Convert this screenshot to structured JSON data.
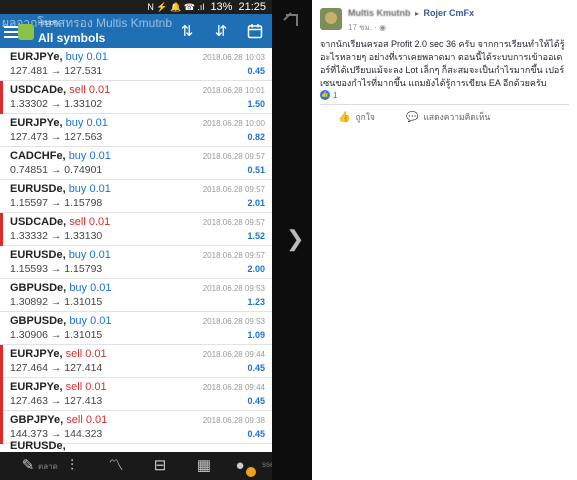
{
  "phone": {
    "status": {
      "signal_text": "N ⚡ 🔔 ☎ .ıl",
      "battery": "13%",
      "time": "21:25"
    },
    "appbar": {
      "overlay_text": "ผลจากโบรสทรอง Multis Kmutnb",
      "subtitle": "History",
      "title": "All symbols",
      "icons": [
        "sort-icon",
        "transfer-icon",
        "calendar-icon"
      ]
    },
    "trades": [
      {
        "symbol": "EURJPYe,",
        "side": "buy 0.01",
        "prices": "127.481 → 127.531",
        "date": "2018.06.28 10:03",
        "profit": "0.45"
      },
      {
        "symbol": "USDCADe,",
        "side": "sell 0.01",
        "prices": "1.33302 → 1.33102",
        "date": "2018.06.28 10:01",
        "profit": "1.50"
      },
      {
        "symbol": "EURJPYe,",
        "side": "buy 0.01",
        "prices": "127.473 → 127.563",
        "date": "2018.06.28 10:00",
        "profit": "0.82"
      },
      {
        "symbol": "CADCHFe,",
        "side": "buy 0.01",
        "prices": "0.74851 → 0.74901",
        "date": "2018.06.28 09:57",
        "profit": "0.51"
      },
      {
        "symbol": "EURUSDe,",
        "side": "buy 0.01",
        "prices": "1.15597 → 1.15798",
        "date": "2018.06.28 09:57",
        "profit": "2.01"
      },
      {
        "symbol": "USDCADe,",
        "side": "sell 0.01",
        "prices": "1.33332 → 1.33130",
        "date": "2018.06.28 09:57",
        "profit": "1.52"
      },
      {
        "symbol": "EURUSDe,",
        "side": "buy 0.01",
        "prices": "1.15593 → 1.15793",
        "date": "2018.06.28 09:57",
        "profit": "2.00"
      },
      {
        "symbol": "GBPUSDe,",
        "side": "buy 0.01",
        "prices": "1.30892 → 1.31015",
        "date": "2018.06.28 09:53",
        "profit": "1.23"
      },
      {
        "symbol": "GBPUSDe,",
        "side": "buy 0.01",
        "prices": "1.30906 → 1.31015",
        "date": "2018.06.28 09:53",
        "profit": "1.09"
      },
      {
        "symbol": "EURJPYe,",
        "side": "sell 0.01",
        "prices": "127.464 → 127.414",
        "date": "2018.06.28 09:44",
        "profit": "0.45"
      },
      {
        "symbol": "EURJPYe,",
        "side": "sell 0.01",
        "prices": "127.463 → 127.413",
        "date": "2018.06.28 09:44",
        "profit": "0.45"
      },
      {
        "symbol": "GBPJPYe,",
        "side": "sell 0.01",
        "prices": "144.373 → 144.323",
        "date": "2018.06.28 09:38",
        "profit": "0.45"
      }
    ],
    "partial_row_text": "EURUSDe,",
    "bottom_nav": {
      "overlay_text": "ตลาด",
      "overlay_text2": "ssenger"
    },
    "colors": {
      "buy": "#1a73d0",
      "sell": "#d32f2f",
      "appbar": "#1f6fb5"
    }
  },
  "viewer": {
    "next_glyph": "❯"
  },
  "post": {
    "author_blurred": "Multis Kmutnb",
    "author": "Rojer CmFx",
    "time": "17 ชม.",
    "body": "จากนักเรียนครอส Profit 2.0 sec 36 ครับ จากการเรียนทำให้ได้รู้อะไรหลายๆ อย่างที่เราเคยพลาดมา ตอนนี้ได้ระบบการเข้าออเดอร์ที่ได้เปรียบแม้จะลง Lot เล็กๆ ก็สะสมจะเป็นกำไรมากขึ้น เปอร์เซนของกำไรที่มากขึ้น แถมยังได้รู้การเขียน EA อีกด้วยครับ",
    "likes_count": "1",
    "like_label": "ถูกใจ",
    "comment_label": "แสดงความคิดเห็น"
  }
}
